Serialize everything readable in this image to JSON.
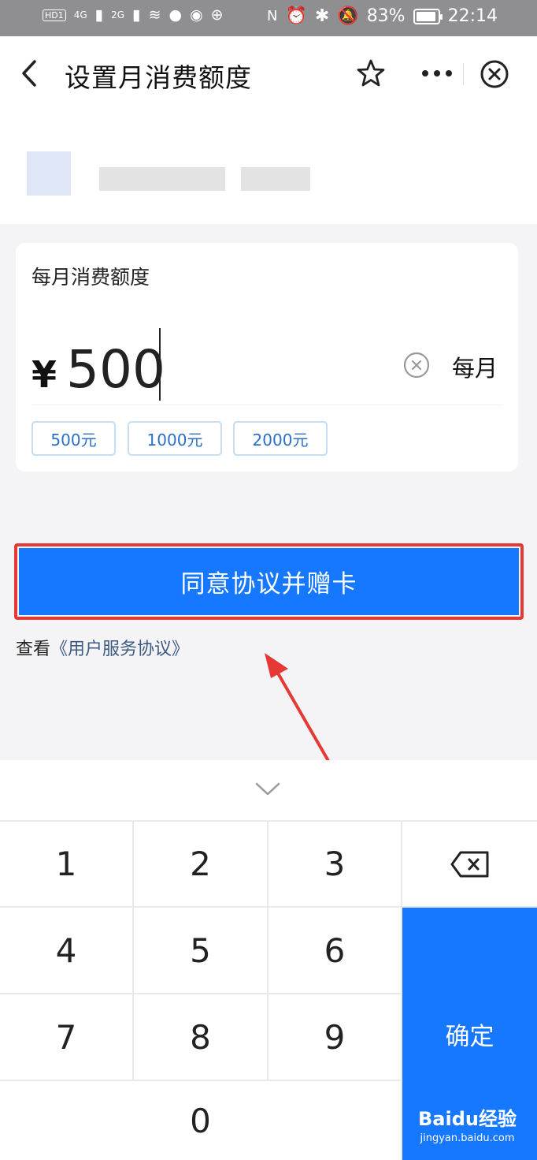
{
  "status_bar": {
    "left_chips": [
      "HD1",
      "4G",
      "2G"
    ],
    "battery": "83%",
    "battery_level": 0.83,
    "time": "22:14"
  },
  "nav": {
    "title": "设置月消费额度",
    "icons": [
      "back-icon",
      "star-icon",
      "more-icon",
      "close-icon"
    ]
  },
  "card": {
    "label": "每月消费额度",
    "currency": "¥",
    "amount": "500",
    "period": "每月",
    "quick_amounts": [
      "500元",
      "1000元",
      "2000元"
    ]
  },
  "agree_button": "同意协议并赠卡",
  "terms": {
    "prefix": "查看",
    "link": "《用户服务协议》"
  },
  "keypad": {
    "keys": [
      "1",
      "2",
      "3",
      "4",
      "5",
      "6",
      "7",
      "8",
      "9",
      "0"
    ],
    "confirm": "确定",
    "backspace_icon": "backspace-icon"
  },
  "watermark": {
    "brand": "Baidu经验",
    "url": "jingyan.baidu.com"
  },
  "colors": {
    "accent": "#1677ff",
    "highlight": "#e53935",
    "link": "#2a6fc8"
  }
}
